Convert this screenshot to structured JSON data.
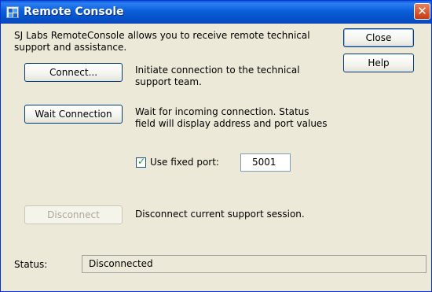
{
  "window": {
    "title": "Remote Console",
    "close_glyph": "✕"
  },
  "intro": "SJ Labs RemoteConsole allows you to receive remote technical support and assistance.",
  "buttons": {
    "close": "Close",
    "help": "Help",
    "connect": "Connect...",
    "wait_connection": "Wait Connection",
    "disconnect": "Disconnect"
  },
  "descriptions": {
    "connect": "Initiate connection to the technical support team.",
    "wait": "Wait for incoming connection. Status field will display address and port values",
    "disconnect": "Disconnect current support session."
  },
  "fixed_port": {
    "label": "Use fixed port:",
    "checked": true,
    "value": "5001"
  },
  "status": {
    "label": "Status:",
    "value": "Disconnected"
  },
  "icons": {
    "app": "remote-console-app-icon",
    "checkmark": "✓"
  }
}
